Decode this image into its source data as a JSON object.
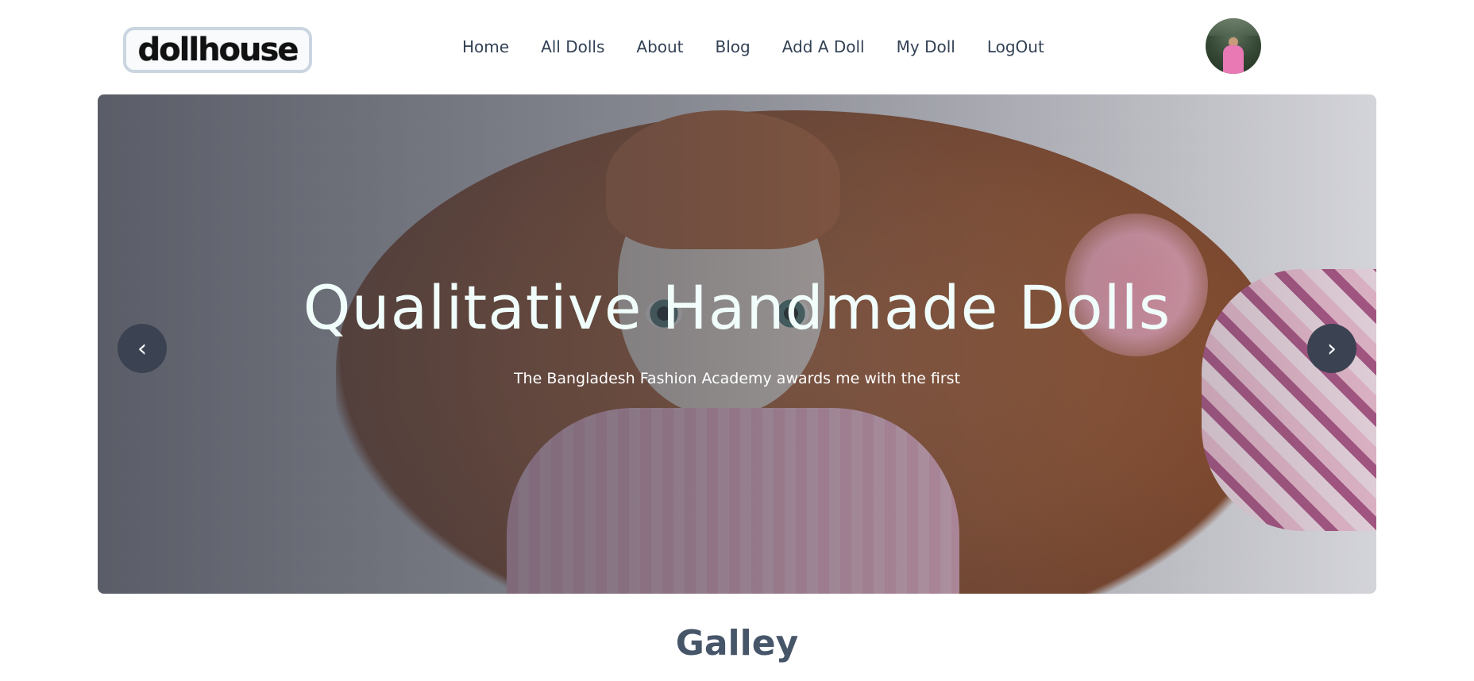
{
  "header": {
    "logo_text": "dollhouse",
    "nav": [
      "Home",
      "All Dolls",
      "About",
      "Blog",
      "Add A Doll",
      "My Doll",
      "LogOut"
    ]
  },
  "banner": {
    "title": "Qualitative Handmade Dolls",
    "subtitle": "The Bangladesh Fashion Academy awards me with the first",
    "prev_icon": "‹",
    "next_icon": "›"
  },
  "gallery": {
    "title": "Galley"
  },
  "colors": {
    "accent_dark": "#3b4252",
    "heading": "#475569",
    "nav_text": "#334155"
  }
}
